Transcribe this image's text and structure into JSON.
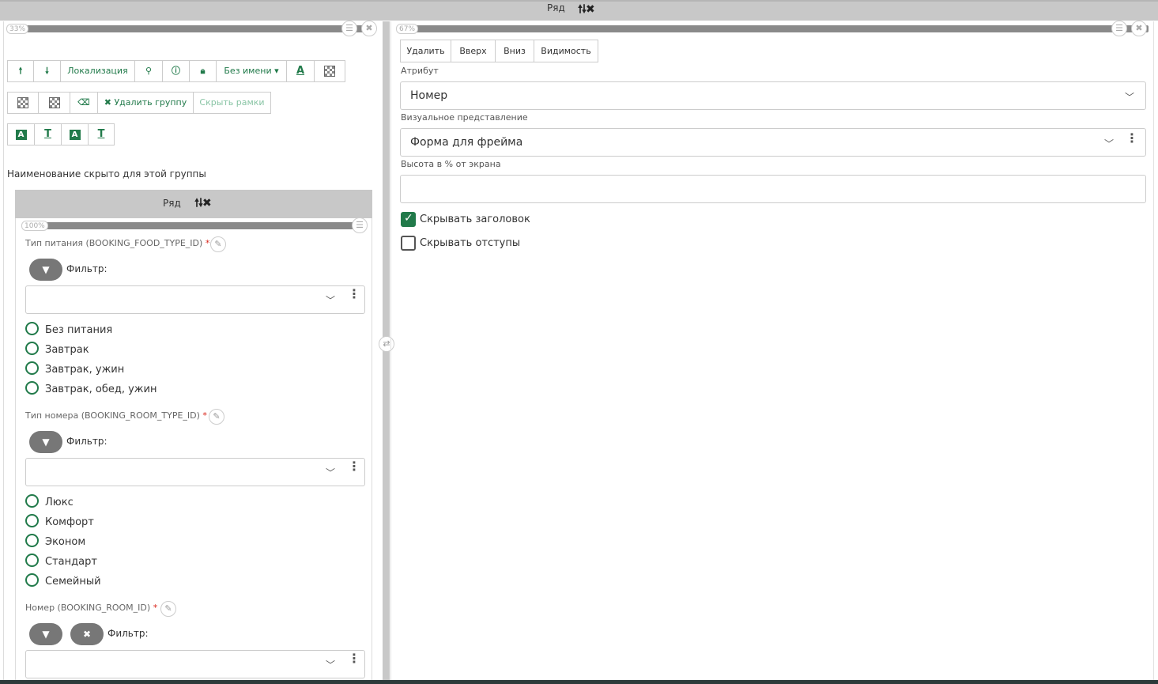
{
  "top_row": {
    "title": "Ряд",
    "arrows": "🠕🠗✖"
  },
  "left": {
    "percent": "33%",
    "toolbar1": {
      "localization": "Локализация",
      "no_name": "Без имени ▾"
    },
    "toolbar2": {
      "delete_group": "Удалить группу",
      "hide_frames": "Скрыть рамки"
    },
    "group_note": "Наименование скрыто для этой группы",
    "inner_row": {
      "title": "Ряд",
      "arrows": "🠕🠗✖",
      "percent": "100%"
    },
    "fields": [
      {
        "label": "Тип питания (BOOKING_FOOD_TYPE_ID)",
        "filter": "Фильтр:",
        "options": [
          "Без питания",
          "Завтрак",
          "Завтрак, ужин",
          "Завтрак, обед, ужин"
        ]
      },
      {
        "label": "Тип номера (BOOKING_ROOM_TYPE_ID)",
        "filter": "Фильтр:",
        "options": [
          "Люкс",
          "Комфорт",
          "Эконом",
          "Стандарт",
          "Семейный"
        ]
      },
      {
        "label": "Номер (BOOKING_ROOM_ID)",
        "filter": "Фильтр:",
        "options": []
      }
    ],
    "required_mark": "*"
  },
  "right": {
    "percent": "67%",
    "buttons": {
      "delete": "Удалить",
      "up": "Вверх",
      "down": "Вниз",
      "visibility": "Видимость"
    },
    "attribute_label": "Атрибут",
    "attribute_value": "Номер",
    "visual_label": "Визуальное представление",
    "visual_value": "Форма для фрейма",
    "height_label": "Высота в % от экрана",
    "height_value": "",
    "hide_header": {
      "label": "Скрывать заголовок",
      "checked": true
    },
    "hide_padding": {
      "label": "Скрывать отступы",
      "checked": false
    }
  },
  "colors": {
    "accent": "#217a4a",
    "header_gray": "#c8c8c8"
  }
}
